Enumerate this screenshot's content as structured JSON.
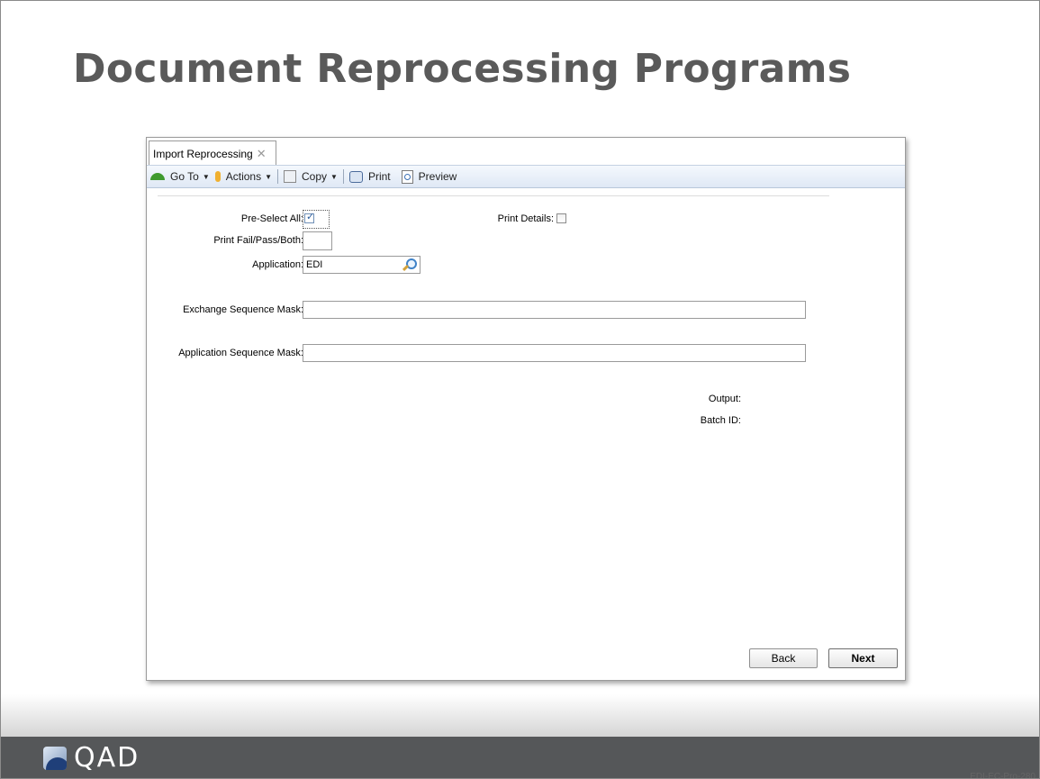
{
  "slide": {
    "title": "Document Reprocessing Programs",
    "code": "EDI-EC-Pro-280",
    "logo_text": "QAD"
  },
  "window": {
    "tab_label": "Import Reprocessing",
    "tab_close_glyph": "✕",
    "toolbar": {
      "goto_label": "Go To",
      "actions_label": "Actions",
      "copy_label": "Copy",
      "print_label": "Print",
      "preview_label": "Preview",
      "dropdown_glyph": "▼"
    },
    "form": {
      "preselect_all_label": "Pre-Select All:",
      "preselect_all_checked": true,
      "print_details_label": "Print Details:",
      "print_details_checked": false,
      "print_fail_pass_both_label": "Print Fail/Pass/Both:",
      "print_fail_pass_both_value": "",
      "application_label": "Application:",
      "application_value": "EDI",
      "exchange_mask_label": "Exchange Sequence Mask:",
      "exchange_mask_value": "",
      "application_mask_label": "Application Sequence Mask:",
      "application_mask_value": "",
      "output_label": "Output:",
      "batch_id_label": "Batch ID:"
    },
    "buttons": {
      "back_label": "Back",
      "next_label": "Next"
    }
  }
}
